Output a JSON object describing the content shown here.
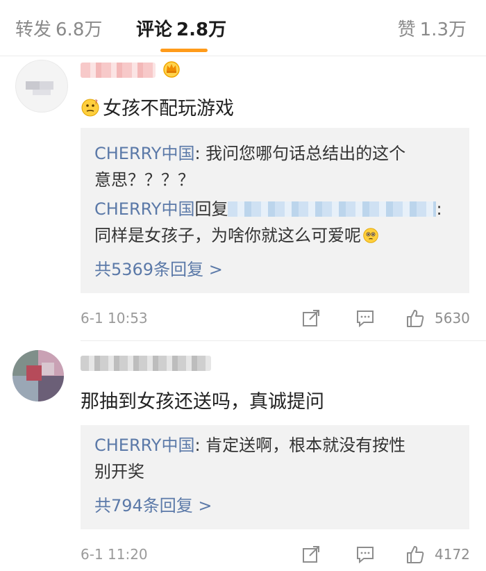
{
  "tabs": {
    "repost": {
      "label": "转发",
      "count": "6.8万"
    },
    "comments": {
      "label": "评论",
      "count": "2.8万"
    },
    "likes": {
      "label": "赞",
      "count": "1.3万"
    }
  },
  "comments": [
    {
      "text": "女孩不配玩游戏",
      "emoji": "thinking-face",
      "replies": {
        "line1_name": "CHERRY中国",
        "line1_text": ": 我问您哪句话总结出的这个",
        "line1_cont": "意思？？？？",
        "line2_name": "CHERRY中国",
        "line2_mid": "回复",
        "line2_end": ":",
        "line2_cont": "同样是女孩子，为啥你就这么可爱呢",
        "more": "共5369条回复 >"
      },
      "time": "6-1 10:53",
      "likes": "5630"
    },
    {
      "text": "那抽到女孩还送吗，真诚提问",
      "replies": {
        "line1_name": "CHERRY中国",
        "line1_text": ": 肯定送啊，根本就没有按性",
        "line1_cont": "别开奖",
        "more": "共794条回复 >"
      },
      "time": "6-1 11:20",
      "likes": "4172"
    }
  ],
  "colors": {
    "accent_orange": "#ff9b1a",
    "link_blue": "#5b79a8"
  }
}
